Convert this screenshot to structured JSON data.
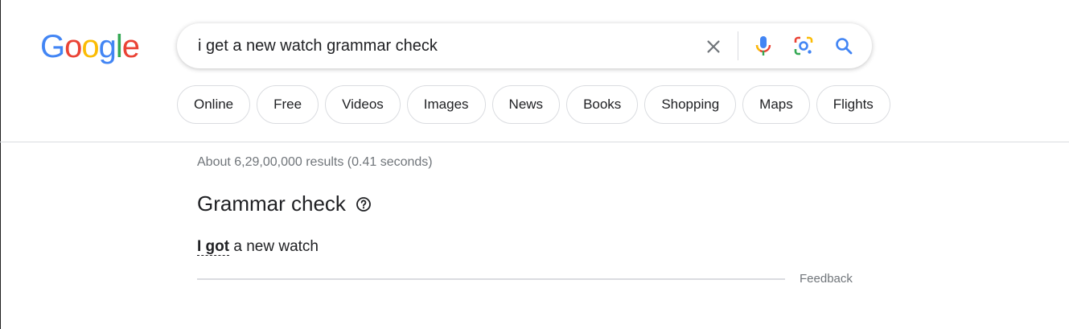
{
  "logo": {
    "letters": [
      {
        "ch": "G",
        "color": "#4285F4"
      },
      {
        "ch": "o",
        "color": "#EA4335"
      },
      {
        "ch": "o",
        "color": "#FBBC05"
      },
      {
        "ch": "g",
        "color": "#4285F4"
      },
      {
        "ch": "l",
        "color": "#34A853"
      },
      {
        "ch": "e",
        "color": "#EA4335"
      }
    ]
  },
  "search": {
    "query": "i get a new watch grammar check",
    "icons": [
      "clear-icon",
      "mic-icon",
      "google-lens-icon",
      "search-icon"
    ]
  },
  "filters": [
    "Online",
    "Free",
    "Videos",
    "Images",
    "News",
    "Books",
    "Shopping",
    "Maps",
    "Flights"
  ],
  "results": {
    "stats": "About 6,29,00,000 results (0.41 seconds)"
  },
  "grammar_check": {
    "title": "Grammar check",
    "help_icon": "help-icon",
    "corrected_bold": "I got",
    "corrected_rest": " a new watch",
    "feedback": "Feedback"
  },
  "colors": {
    "blue": "#4285F4",
    "red": "#EA4335",
    "yellow": "#FBBC05",
    "green": "#34A853"
  }
}
